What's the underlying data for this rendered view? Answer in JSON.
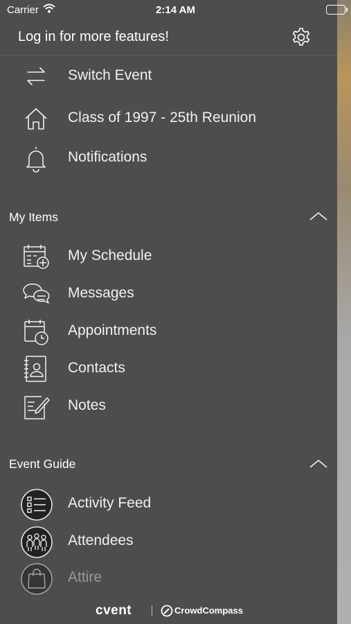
{
  "status_bar": {
    "carrier": "Carrier",
    "time": "2:14 AM"
  },
  "header": {
    "title": "Log in for more features!",
    "settings_icon": "gear-icon"
  },
  "top_items": [
    {
      "label": "Switch Event",
      "icon": "switch-arrows-icon"
    },
    {
      "label": "Class of 1997 - 25th Reunion",
      "icon": "home-icon"
    },
    {
      "label": "Notifications",
      "icon": "bell-icon"
    }
  ],
  "my_items": {
    "title": "My Items",
    "items": [
      {
        "label": "My Schedule",
        "icon": "calendar-add-icon"
      },
      {
        "label": "Messages",
        "icon": "chat-bubbles-icon"
      },
      {
        "label": "Appointments",
        "icon": "calendar-clock-icon"
      },
      {
        "label": "Contacts",
        "icon": "address-book-icon"
      },
      {
        "label": "Notes",
        "icon": "note-pencil-icon"
      }
    ]
  },
  "event_guide": {
    "title": "Event Guide",
    "items": [
      {
        "label": "Activity Feed",
        "icon": "activity-list-icon"
      },
      {
        "label": "Attendees",
        "icon": "people-group-icon"
      },
      {
        "label": "Attire",
        "icon": "shopping-bag-icon"
      }
    ]
  },
  "footer": {
    "brand": "cvent",
    "partner": "CrowdCompass"
  },
  "colors": {
    "drawer_bg": "#4d4d4d",
    "text": "#f0f0f0",
    "icon_circle": "#222222"
  }
}
